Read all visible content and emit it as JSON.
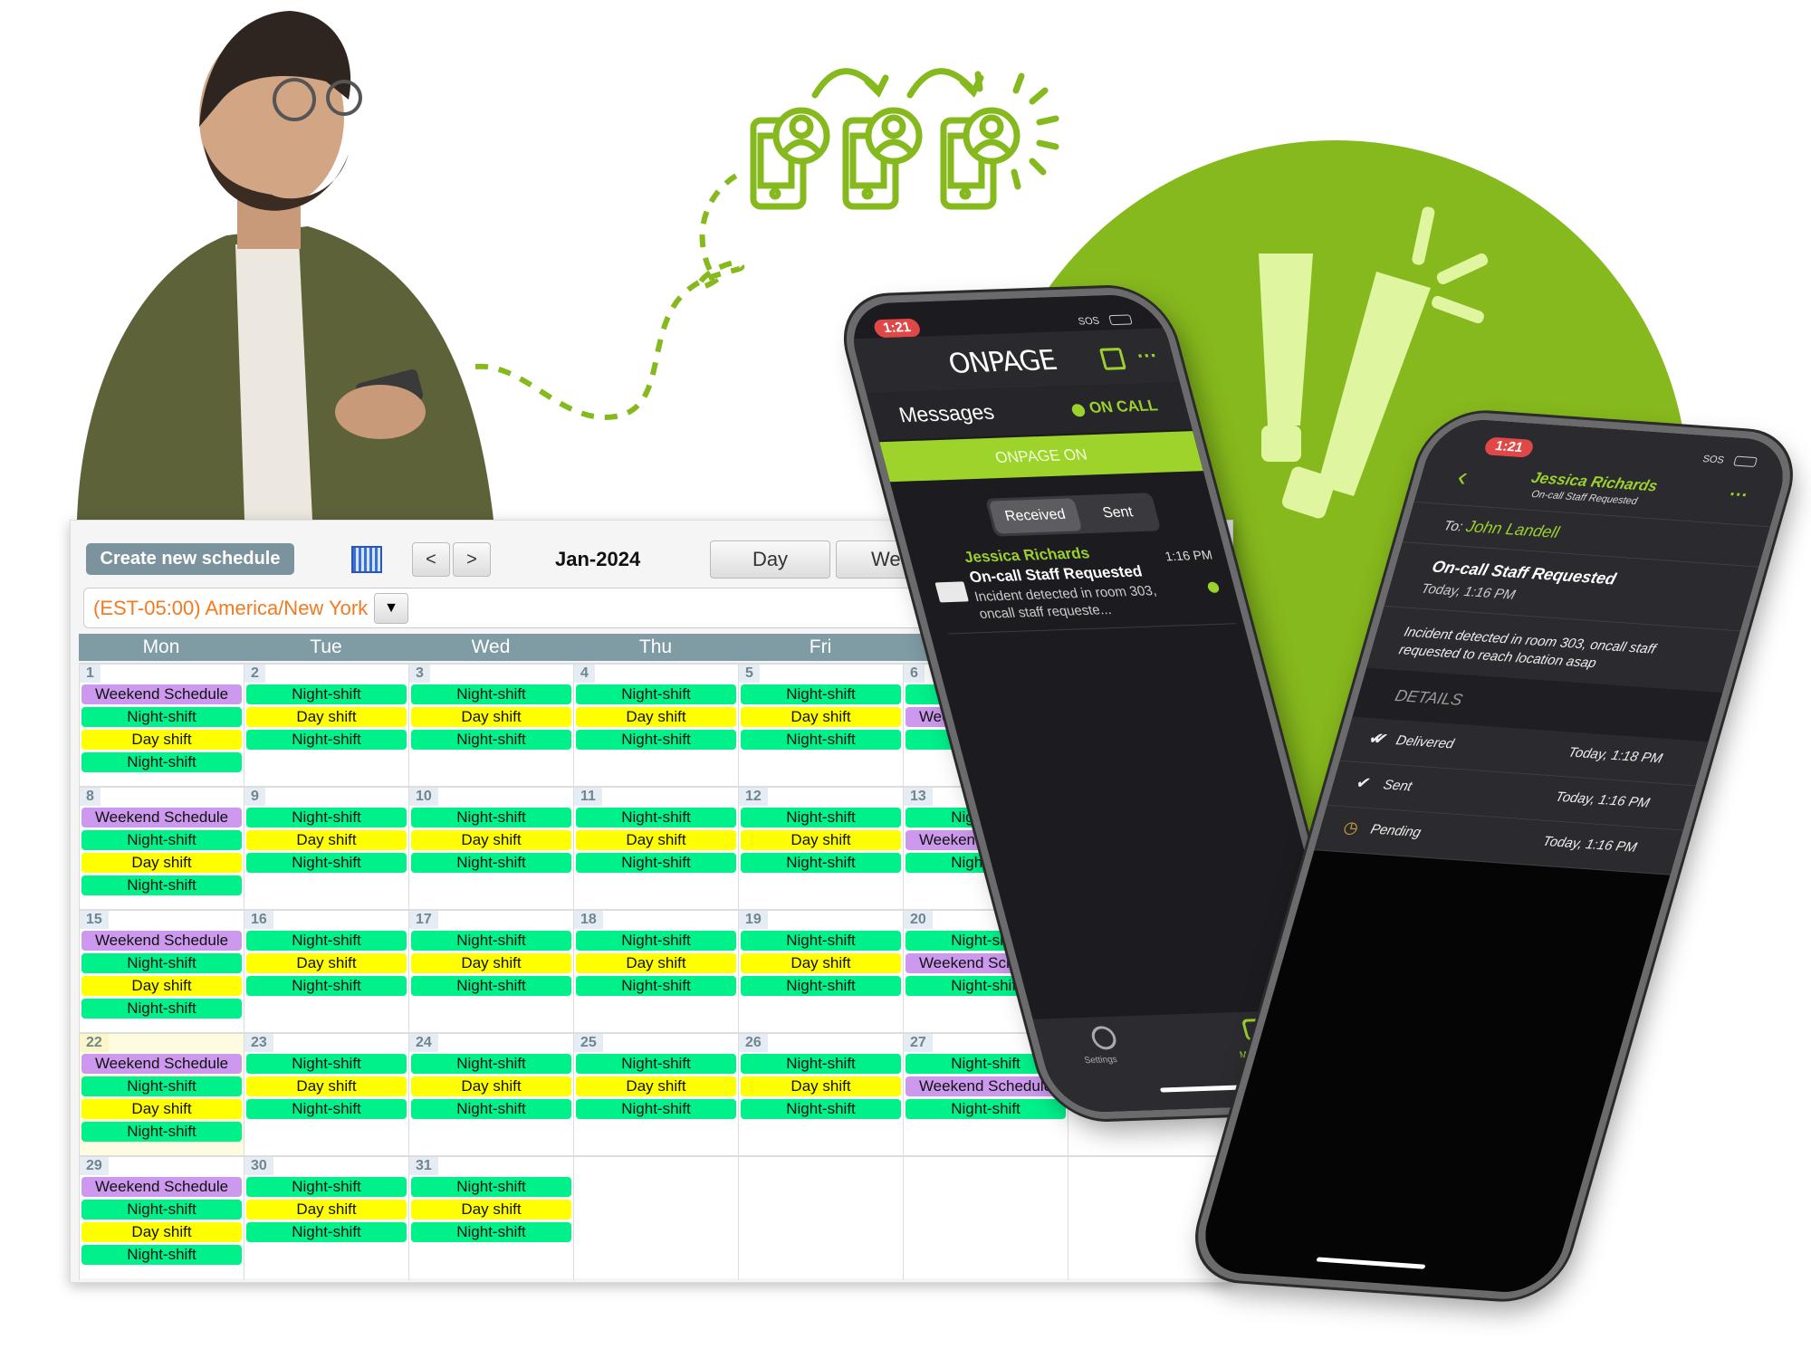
{
  "colors": {
    "brand_green": "#86b91d",
    "light_green": "#dff5a0",
    "night_shift": "#00f08a",
    "day_shift": "#ffff00",
    "weekend": "#cc99ee",
    "timezone_text": "#f47a20",
    "header_bg": "#7f9ba4"
  },
  "calendar": {
    "create_button": "Create new schedule",
    "prev": "<",
    "next": ">",
    "month": "Jan-2024",
    "views": [
      "Day",
      "Week"
    ],
    "timezone": "(EST-05:00) America/New York",
    "timezone_dropdown": "▼",
    "weekday_headers": [
      "Mon",
      "Tue",
      "Wed",
      "Thu",
      "Fri",
      "",
      ""
    ],
    "today": 22,
    "weeks": [
      [
        {
          "d": "1",
          "e": [
            "Weekend Schedule",
            "Night-shift",
            "Day shift",
            "Night-shift"
          ]
        },
        {
          "d": "2",
          "e": [
            "Night-shift",
            "Day shift",
            "Night-shift"
          ]
        },
        {
          "d": "3",
          "e": [
            "Night-shift",
            "Day shift",
            "Night-shift"
          ]
        },
        {
          "d": "4",
          "e": [
            "Night-shift",
            "Day shift",
            "Night-shift"
          ]
        },
        {
          "d": "5",
          "e": [
            "Night-shift",
            "Day shift",
            "Night-shift"
          ]
        },
        {
          "d": "6",
          "e": [
            "Night-shift",
            "Weekend Schedule",
            "Night-shift"
          ]
        },
        {
          "d": "",
          "e": []
        }
      ],
      [
        {
          "d": "8",
          "e": [
            "Weekend Schedule",
            "Night-shift",
            "Day shift",
            "Night-shift"
          ]
        },
        {
          "d": "9",
          "e": [
            "Night-shift",
            "Day shift",
            "Night-shift"
          ]
        },
        {
          "d": "10",
          "e": [
            "Night-shift",
            "Day shift",
            "Night-shift"
          ]
        },
        {
          "d": "11",
          "e": [
            "Night-shift",
            "Day shift",
            "Night-shift"
          ]
        },
        {
          "d": "12",
          "e": [
            "Night-shift",
            "Day shift",
            "Night-shift"
          ]
        },
        {
          "d": "13",
          "e": [
            "Night-shift",
            "Weekend Schedule",
            "Night-shift"
          ]
        },
        {
          "d": "",
          "e": []
        }
      ],
      [
        {
          "d": "15",
          "e": [
            "Weekend Schedule",
            "Night-shift",
            "Day shift",
            "Night-shift"
          ]
        },
        {
          "d": "16",
          "e": [
            "Night-shift",
            "Day shift",
            "Night-shift"
          ]
        },
        {
          "d": "17",
          "e": [
            "Night-shift",
            "Day shift",
            "Night-shift"
          ]
        },
        {
          "d": "18",
          "e": [
            "Night-shift",
            "Day shift",
            "Night-shift"
          ]
        },
        {
          "d": "19",
          "e": [
            "Night-shift",
            "Day shift",
            "Night-shift"
          ]
        },
        {
          "d": "20",
          "e": [
            "Night-shift",
            "Weekend Schedule",
            "Night-shift"
          ]
        },
        {
          "d": "",
          "e": []
        }
      ],
      [
        {
          "d": "22",
          "e": [
            "Weekend Schedule",
            "Night-shift",
            "Day shift",
            "Night-shift"
          ]
        },
        {
          "d": "23",
          "e": [
            "Night-shift",
            "Day shift",
            "Night-shift"
          ]
        },
        {
          "d": "24",
          "e": [
            "Night-shift",
            "Day shift",
            "Night-shift"
          ]
        },
        {
          "d": "25",
          "e": [
            "Night-shift",
            "Day shift",
            "Night-shift"
          ]
        },
        {
          "d": "26",
          "e": [
            "Night-shift",
            "Day shift",
            "Night-shift"
          ]
        },
        {
          "d": "27",
          "e": [
            "Night-shift",
            "Weekend Schedule",
            "Night-shift"
          ]
        },
        {
          "d": "",
          "e": []
        }
      ],
      [
        {
          "d": "29",
          "e": [
            "Weekend Schedule",
            "Night-shift",
            "Day shift",
            "Night-shift"
          ]
        },
        {
          "d": "30",
          "e": [
            "Night-shift",
            "Day shift",
            "Night-shift"
          ]
        },
        {
          "d": "31",
          "e": [
            "Night-shift",
            "Day shift",
            "Night-shift"
          ]
        },
        {
          "d": "",
          "e": []
        },
        {
          "d": "",
          "e": []
        },
        {
          "d": "",
          "e": []
        },
        {
          "d": "",
          "e": []
        }
      ]
    ]
  },
  "phone_inbox": {
    "time": "1:21",
    "signal": "SOS",
    "logo": "ONPAGE",
    "title": "Messages",
    "status": "ON CALL",
    "banner": "ONPAGE ON",
    "tabs": [
      "Received",
      "Sent"
    ],
    "message": {
      "sender": "Jessica Richards",
      "subject": "On-call Staff Requested",
      "preview": "Incident detected in room 303, oncall staff requeste...",
      "time": "1:16 PM"
    },
    "bottom_tabs": [
      "Settings",
      "Messages"
    ]
  },
  "phone_detail": {
    "time": "1:21",
    "signal": "SOS",
    "title": "Jessica Richards",
    "subtitle": "On-call Staff Requested",
    "to_label": "To:",
    "to": "John Landell",
    "subject": "On-call Staff Requested",
    "date": "Today, 1:16 PM",
    "body": "Incident detected in room 303, oncall staff requested to reach location asap",
    "details_label": "DETAILS",
    "details": [
      {
        "status": "Delivered",
        "time": "Today, 1:18 PM",
        "icon": "double-check-icon"
      },
      {
        "status": "Sent",
        "time": "Today, 1:16 PM",
        "icon": "check-icon"
      },
      {
        "status": "Pending",
        "time": "Today, 1:16 PM",
        "icon": "clock-icon"
      }
    ]
  }
}
